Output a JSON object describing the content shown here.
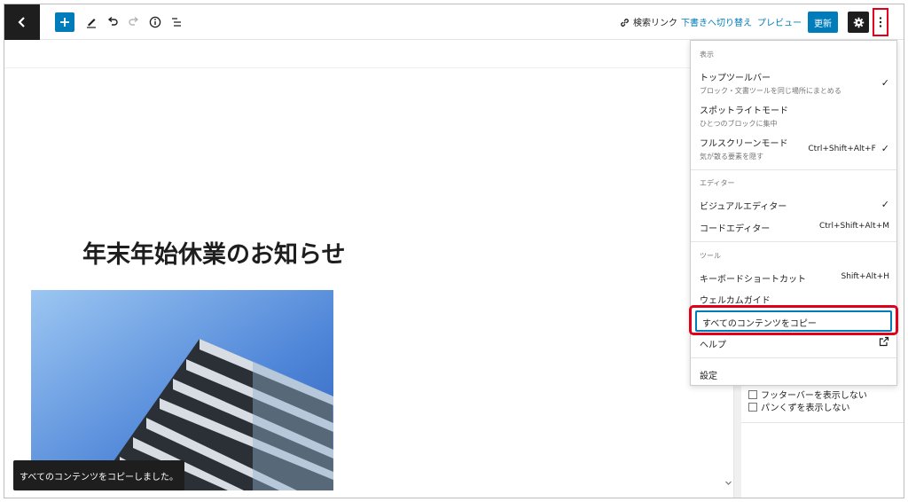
{
  "toolbar": {
    "search_link": "検索リンク",
    "switch_draft": "下書きへ切り替え",
    "preview": "プレビュー",
    "update": "更新"
  },
  "post": {
    "title": "年末年始休業のお知らせ"
  },
  "sidebar": {
    "options": [
      {
        "label": "フッターバーを表示しない",
        "checked": false
      },
      {
        "label": "パンくずを表示しない",
        "checked": false
      }
    ]
  },
  "menu": {
    "view": {
      "title": "表示",
      "items": [
        {
          "label": "トップツールバー",
          "description": "ブロック・文書ツールを同じ場所にまとめる",
          "shortcut": "",
          "checked": true
        },
        {
          "label": "スポットライトモード",
          "description": "ひとつのブロックに集中",
          "shortcut": "",
          "checked": false
        },
        {
          "label": "フルスクリーンモード",
          "description": "気が散る要素を隠す",
          "shortcut": "Ctrl+Shift+Alt+F",
          "checked": true
        }
      ]
    },
    "editor": {
      "title": "エディター",
      "items": [
        {
          "label": "ビジュアルエディター",
          "shortcut": "",
          "checked": true
        },
        {
          "label": "コードエディター",
          "shortcut": "Ctrl+Shift+Alt+M",
          "checked": false
        }
      ]
    },
    "tools": {
      "title": "ツール",
      "items": [
        {
          "label": "キーボードショートカット",
          "shortcut": "Shift+Alt+H"
        },
        {
          "label": "ウェルカムガイド",
          "shortcut": ""
        },
        {
          "label": "すべてのコンテンツをコピー",
          "shortcut": ""
        },
        {
          "label": "ヘルプ",
          "icon": "external-link-icon"
        }
      ]
    },
    "settings": "設定"
  },
  "snackbar": {
    "message": "すべてのコンテンツをコピーしました。"
  },
  "colors": {
    "accent": "#007cba",
    "dark": "#1e1e1e",
    "highlight": "#e0001b"
  }
}
